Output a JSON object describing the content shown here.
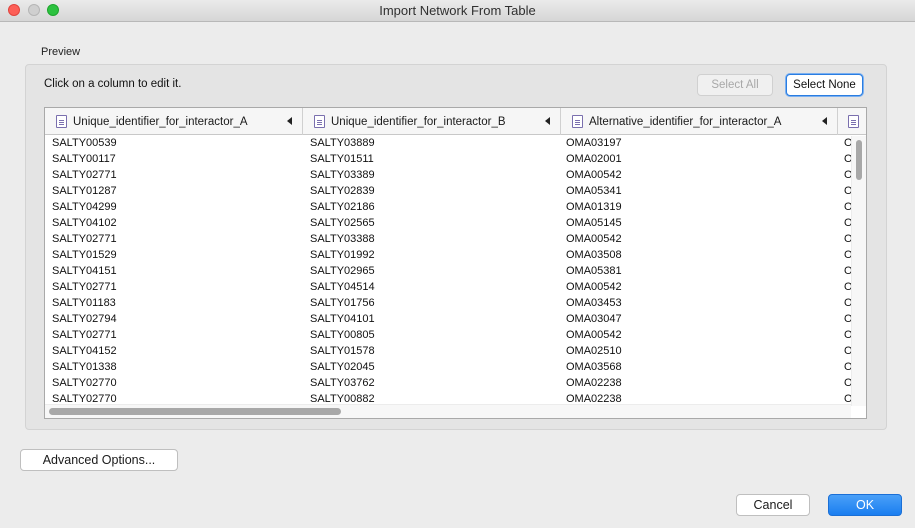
{
  "window": {
    "title": "Import Network From Table"
  },
  "preview": {
    "label": "Preview",
    "instruction": "Click on a column to edit it.",
    "select_all_label": "Select All",
    "select_none_label": "Select None"
  },
  "table": {
    "columns": [
      "Unique_identifier_for_interactor_A",
      "Unique_identifier_for_interactor_B",
      "Alternative_identifier_for_interactor_A",
      ""
    ],
    "rows": [
      [
        "SALTY00539",
        "SALTY03889",
        "OMA03197",
        "O"
      ],
      [
        "SALTY00117",
        "SALTY01511",
        "OMA02001",
        "O"
      ],
      [
        "SALTY02771",
        "SALTY03389",
        "OMA00542",
        "O"
      ],
      [
        "SALTY01287",
        "SALTY02839",
        "OMA05341",
        "O"
      ],
      [
        "SALTY04299",
        "SALTY02186",
        "OMA01319",
        "O"
      ],
      [
        "SALTY04102",
        "SALTY02565",
        "OMA05145",
        "O"
      ],
      [
        "SALTY02771",
        "SALTY03388",
        "OMA00542",
        "O"
      ],
      [
        "SALTY01529",
        "SALTY01992",
        "OMA03508",
        "O"
      ],
      [
        "SALTY04151",
        "SALTY02965",
        "OMA05381",
        "O"
      ],
      [
        "SALTY02771",
        "SALTY04514",
        "OMA00542",
        "O"
      ],
      [
        "SALTY01183",
        "SALTY01756",
        "OMA03453",
        "O"
      ],
      [
        "SALTY02794",
        "SALTY04101",
        "OMA03047",
        "O"
      ],
      [
        "SALTY02771",
        "SALTY00805",
        "OMA00542",
        "O"
      ],
      [
        "SALTY04152",
        "SALTY01578",
        "OMA02510",
        "O"
      ],
      [
        "SALTY01338",
        "SALTY02045",
        "OMA03568",
        "O"
      ],
      [
        "SALTY02770",
        "SALTY03762",
        "OMA02238",
        "O"
      ],
      [
        "SALTY02770",
        "SALTY00882",
        "OMA02238",
        "O"
      ]
    ]
  },
  "footer": {
    "advanced_label": "Advanced Options...",
    "cancel_label": "Cancel",
    "ok_label": "OK"
  }
}
